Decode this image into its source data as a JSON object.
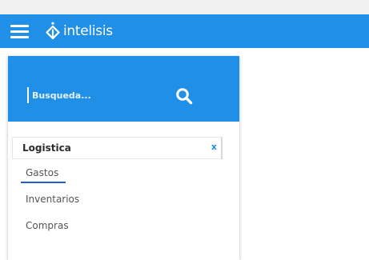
{
  "header": {
    "brand_name": "intelisis",
    "bar_color": "#1f8fe8",
    "menu_icon": "hamburger-menu-icon",
    "logo_icon": "intelisis-logo-icon"
  },
  "sidebar": {
    "search": {
      "placeholder": "Busqueda...",
      "value": "",
      "icon": "search-icon"
    },
    "section": {
      "title": "Logistica",
      "close_label": "x"
    },
    "items": [
      {
        "label": "Gastos",
        "active": true
      },
      {
        "label": "Inventarios",
        "active": false
      },
      {
        "label": "Compras",
        "active": false
      }
    ]
  }
}
